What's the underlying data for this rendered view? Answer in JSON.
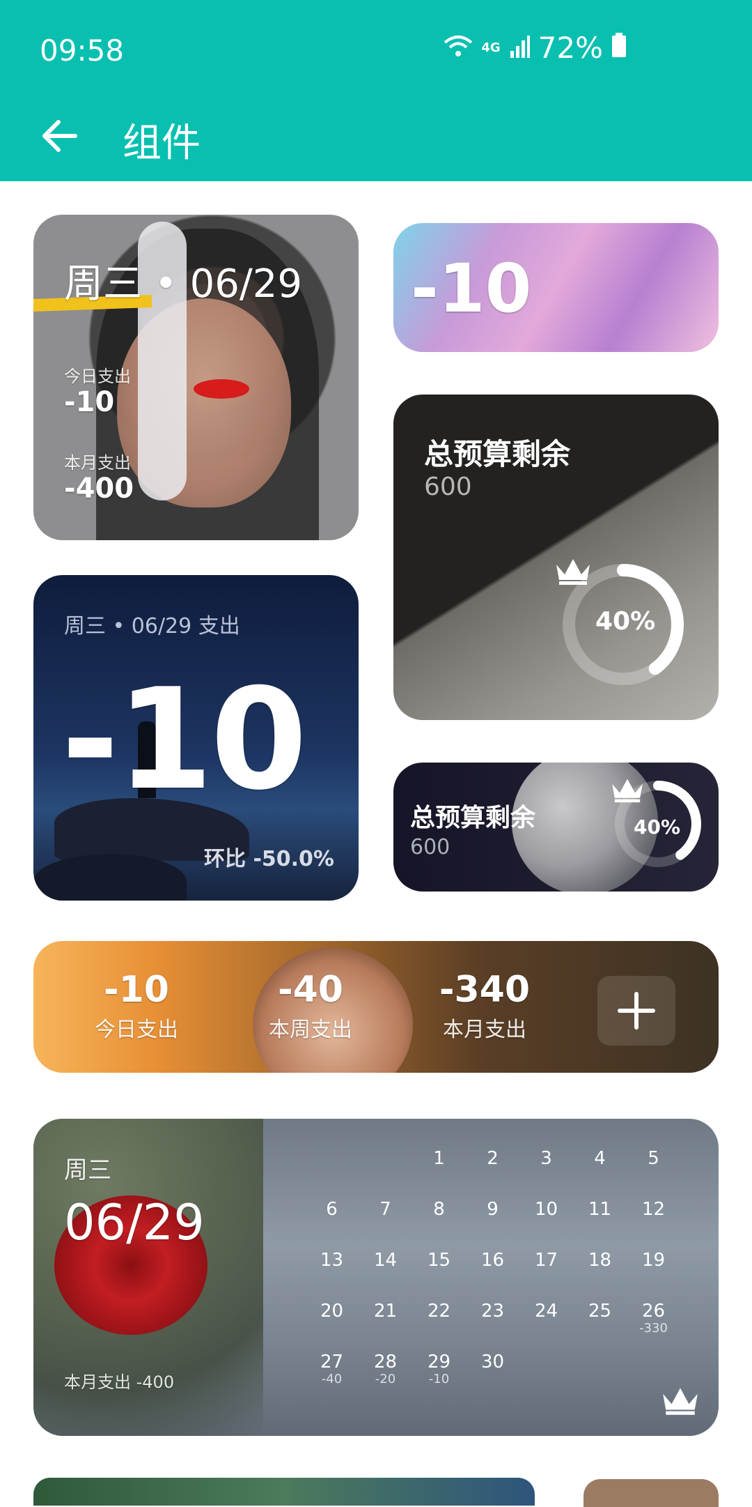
{
  "status_bar": {
    "time": "09:58",
    "network": "4G",
    "battery": "72%"
  },
  "app_bar": {
    "title": "组件"
  },
  "colors": {
    "primary": "#08bfb0"
  },
  "widgets": {
    "portrait_card": {
      "date": "周三 • 06/29",
      "today_label": "今日支出",
      "today_value": "-10",
      "month_label": "本月支出",
      "month_value": "-400"
    },
    "crystal_card": {
      "value": "-10"
    },
    "budget_card_large": {
      "title": "总预算剩余",
      "value": "600",
      "percent": "40%",
      "progress_fraction": 0.4
    },
    "night_card": {
      "header": "周三 • 06/29 支出",
      "value": "-10",
      "footer": "环比 -50.0%"
    },
    "budget_card_small": {
      "title": "总预算剩余",
      "value": "600",
      "percent": "40%",
      "progress_fraction": 0.4
    },
    "summary_card": {
      "stats": [
        {
          "value": "-10",
          "label": "今日支出"
        },
        {
          "value": "-40",
          "label": "本周支出"
        },
        {
          "value": "-340",
          "label": "本月支出"
        }
      ],
      "add_icon": "plus-icon"
    },
    "calendar_card": {
      "weekday": "周三",
      "date": "06/29",
      "month_spend": "本月支出 -400",
      "days": [
        {
          "day": "",
          "sub": ""
        },
        {
          "day": "",
          "sub": ""
        },
        {
          "day": "1",
          "sub": ""
        },
        {
          "day": "2",
          "sub": ""
        },
        {
          "day": "3",
          "sub": ""
        },
        {
          "day": "4",
          "sub": ""
        },
        {
          "day": "5",
          "sub": ""
        },
        {
          "day": "6",
          "sub": ""
        },
        {
          "day": "7",
          "sub": ""
        },
        {
          "day": "8",
          "sub": ""
        },
        {
          "day": "9",
          "sub": ""
        },
        {
          "day": "10",
          "sub": ""
        },
        {
          "day": "11",
          "sub": ""
        },
        {
          "day": "12",
          "sub": ""
        },
        {
          "day": "13",
          "sub": ""
        },
        {
          "day": "14",
          "sub": ""
        },
        {
          "day": "15",
          "sub": ""
        },
        {
          "day": "16",
          "sub": ""
        },
        {
          "day": "17",
          "sub": ""
        },
        {
          "day": "18",
          "sub": ""
        },
        {
          "day": "19",
          "sub": ""
        },
        {
          "day": "20",
          "sub": ""
        },
        {
          "day": "21",
          "sub": ""
        },
        {
          "day": "22",
          "sub": ""
        },
        {
          "day": "23",
          "sub": ""
        },
        {
          "day": "24",
          "sub": ""
        },
        {
          "day": "25",
          "sub": ""
        },
        {
          "day": "26",
          "sub": "-330"
        },
        {
          "day": "27",
          "sub": "-40"
        },
        {
          "day": "28",
          "sub": "-20"
        },
        {
          "day": "29",
          "sub": "-10"
        },
        {
          "day": "30",
          "sub": ""
        }
      ]
    }
  }
}
